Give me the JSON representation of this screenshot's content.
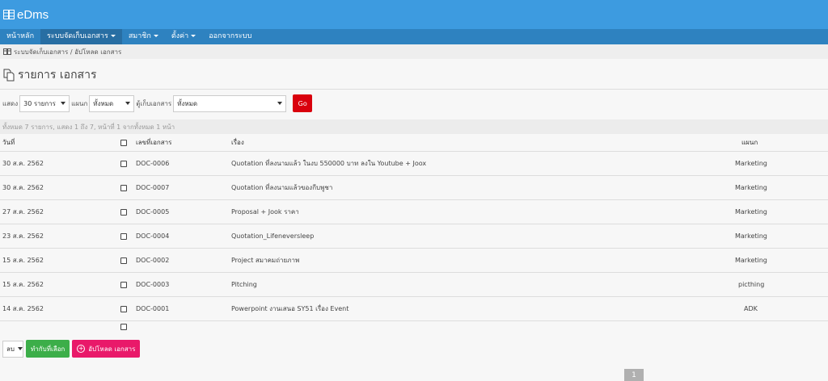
{
  "app": {
    "brand": "eDms"
  },
  "nav": {
    "items": [
      {
        "label": "หน้าหลัก",
        "caret": false,
        "active": false
      },
      {
        "label": "ระบบจัดเก็บเอกสาร",
        "caret": true,
        "active": true
      },
      {
        "label": "สมาชิก",
        "caret": true,
        "active": false
      },
      {
        "label": "ตั้งค่า",
        "caret": true,
        "active": false
      },
      {
        "label": "ออกจากระบบ",
        "caret": false,
        "active": false
      }
    ]
  },
  "breadcrumb": {
    "text": "ระบบจัดเก็บเอกสาร / อัปโหลด เอกสาร"
  },
  "page": {
    "title": "รายการ เอกสาร"
  },
  "filters": {
    "show_label": "แสดง",
    "show_value": "30 รายการ",
    "dept_label": "แผนก",
    "dept_value": "ทั้งหมด",
    "cabinet_label": "ตู้เก็บเอกสาร",
    "cabinet_value": "ทั้งหมด",
    "go_label": "Go"
  },
  "summary": {
    "text": "ทั้งหมด 7 รายการ, แสดง 1 ถึง 7, หน้าที่ 1 จากทั้งหมด 1 หน้า"
  },
  "table": {
    "headers": {
      "date": "วันที่",
      "doc_no": "เลขที่เอกสาร",
      "subject": "เรื่อง",
      "dept": "แผนก"
    },
    "rows": [
      {
        "date": "30 ส.ค. 2562",
        "doc_no": "DOC-0006",
        "subject": "Quotation ที่ลงนามแล้ว ในงบ 550000 บาท ลงใน Youtube + Joox",
        "dept": "Marketing"
      },
      {
        "date": "30 ส.ค. 2562",
        "doc_no": "DOC-0007",
        "subject": "Quotation ที่ลงนามแล้วของกีบพูชา",
        "dept": "Marketing"
      },
      {
        "date": "27 ส.ค. 2562",
        "doc_no": "DOC-0005",
        "subject": "Proposal + Jook ราคา",
        "dept": "Marketing"
      },
      {
        "date": "23 ส.ค. 2562",
        "doc_no": "DOC-0004",
        "subject": "Quotation_Lifeneversleep",
        "dept": "Marketing"
      },
      {
        "date": "15 ส.ค. 2562",
        "doc_no": "DOC-0002",
        "subject": "Project สมาคมถ่ายภาพ",
        "dept": "Marketing"
      },
      {
        "date": "15 ส.ค. 2562",
        "doc_no": "DOC-0003",
        "subject": "Pitching",
        "dept": "picthing"
      },
      {
        "date": "14 ส.ค. 2562",
        "doc_no": "DOC-0001",
        "subject": "Powerpoint งานเสนอ SY51 เรื่อง Event",
        "dept": "ADK"
      }
    ]
  },
  "bottom": {
    "action_select": "ลบ",
    "apply_label": "ทำกับที่เลือก",
    "upload_label": "อัปโหลด เอกสาร"
  },
  "pagination": {
    "current": "1"
  },
  "colors": {
    "topbar": "#3d9be0",
    "navbar": "#2e82c0",
    "go": "#d9000d",
    "apply": "#3cae49",
    "upload": "#e9196a"
  }
}
